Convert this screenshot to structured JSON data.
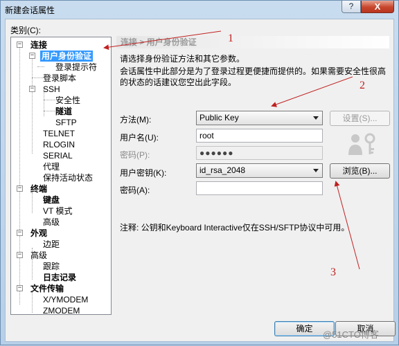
{
  "window": {
    "title": "新建会话属性",
    "help_label": "?",
    "close_label": "X"
  },
  "category_label": "类别(C):",
  "tree": {
    "connection": "连接",
    "user_auth": "用户身份验证",
    "login_prompt": "登录提示符",
    "login_script": "登录脚本",
    "ssh": "SSH",
    "security": "安全性",
    "tunnel": "隧道",
    "sftp": "SFTP",
    "telnet": "TELNET",
    "rlogin": "RLOGIN",
    "serial": "SERIAL",
    "proxy": "代理",
    "keepalive": "保持活动状态",
    "terminal": "终端",
    "keyboard": "键盘",
    "vt_mode": "VT 模式",
    "advanced1": "高级",
    "appearance": "外观",
    "margin": "边距",
    "advanced": "高级",
    "trace": "跟踪",
    "logging": "日志记录",
    "file_transfer": "文件传输",
    "xymodem": "X/YMODEM",
    "zmodem": "ZMODEM"
  },
  "panel": {
    "header": "连接 > 用户身份验证",
    "desc1": "请选择身份验证方法和其它参数。",
    "desc2": "会话属性中此部分是为了登录过程更便捷而提供的。如果需要安全性很高的状态的话建议您空出此字段。",
    "method_label": "方法(M):",
    "method_value": "Public Key",
    "settings_button": "设置(S)...",
    "username_label": "用户名(U):",
    "username_value": "root",
    "password_label": "密码(P):",
    "password_value": "●●●●●●",
    "userkey_label": "用户密钥(K):",
    "userkey_value": "id_rsa_2048",
    "browse_button": "浏览(B)...",
    "passphrase_label": "密码(A):",
    "passphrase_value": "",
    "note": "注释: 公钥和Keyboard Interactive仅在SSH/SFTP协议中可用。"
  },
  "footer": {
    "ok_button": "确定",
    "cancel_button": "取消"
  },
  "annotations": {
    "a1": "1",
    "a2": "2",
    "a3": "3",
    "color": "#c02020"
  },
  "watermark": "@51CTO博客"
}
